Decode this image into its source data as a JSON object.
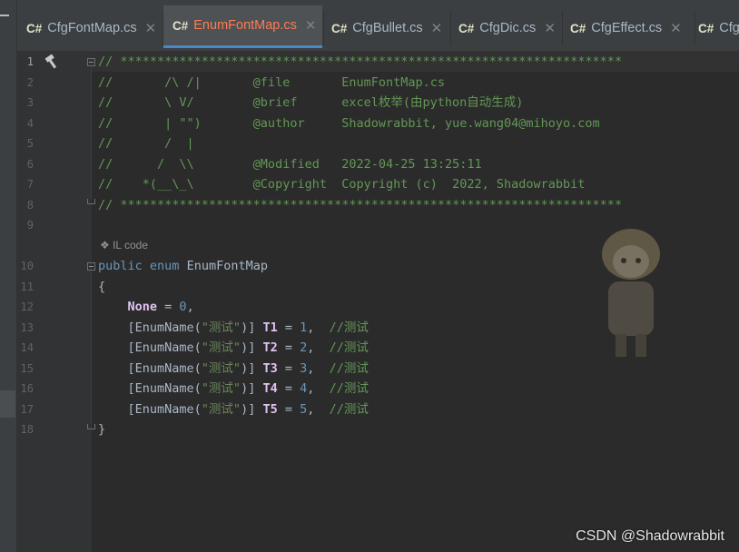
{
  "tabs": [
    {
      "icon": "C#",
      "label": "CfgFontMap.cs",
      "close": "✕",
      "active": false
    },
    {
      "icon": "C#",
      "label": "EnumFontMap.cs",
      "close": "✕",
      "active": true
    },
    {
      "icon": "C#",
      "label": "CfgBullet.cs",
      "close": "✕",
      "active": false
    },
    {
      "icon": "C#",
      "label": "CfgDic.cs",
      "close": "✕",
      "active": false
    },
    {
      "icon": "C#",
      "label": "CfgEffect.cs",
      "close": "✕",
      "active": false
    },
    {
      "icon": "C#",
      "label": "Cfg",
      "close": "",
      "active": false
    }
  ],
  "line_numbers": [
    "1",
    "2",
    "3",
    "4",
    "5",
    "6",
    "7",
    "8",
    "9",
    "10",
    "11",
    "12",
    "13",
    "14",
    "15",
    "16",
    "17",
    "18"
  ],
  "il_code": "IL code",
  "code": {
    "l1": "// ********************************************************************",
    "l2": "//       /\\ /|       @file       EnumFontMap.cs",
    "l3": "//       \\ V/        @brief      excel枚举(由python自动生成)",
    "l4": "//       | \"\")       @author     Shadowrabbit, yue.wang04@mihoyo.com",
    "l5": "//       /  |",
    "l6": "//      /  \\\\        @Modified   2022-04-25 13:25:11",
    "l7": "//    *(__\\_\\        @Copyright  Copyright (c)  2022, Shadowrabbit",
    "l8": "// ********************************************************************",
    "l10_kw1": "public",
    "l10_kw2": "enum",
    "l10_name": "EnumFontMap",
    "l11": "{",
    "l12_name": "None",
    "l12_rest": " = ",
    "l12_val": "0",
    "l12_end": ",",
    "attr_open": "[EnumName(",
    "attr_str": "\"测试\"",
    "attr_close": ")] ",
    "eq": " = ",
    "comma": ",  ",
    "comment": "//测试",
    "members": [
      {
        "name": "T1",
        "value": "1"
      },
      {
        "name": "T2",
        "value": "2"
      },
      {
        "name": "T3",
        "value": "3"
      },
      {
        "name": "T4",
        "value": "4"
      },
      {
        "name": "T5",
        "value": "5"
      }
    ],
    "l18": "}"
  },
  "watermark": "CSDN @Shadowrabbit",
  "colors": {
    "active_tab_text": "#ff7b52",
    "comment": "#629755",
    "keyword": "#cc7832",
    "number": "#6897bb",
    "enum_member": "#e0c2f0",
    "tab_underline": "#4a88c7"
  }
}
